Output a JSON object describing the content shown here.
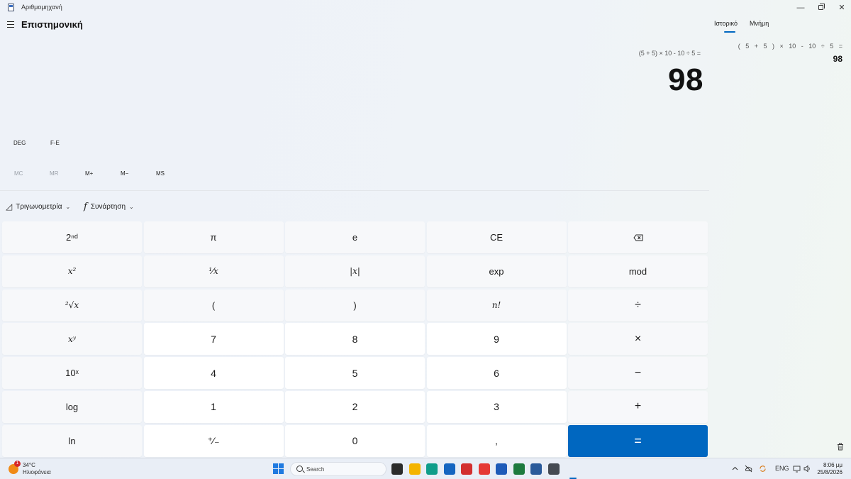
{
  "window": {
    "title": "Αριθμομηχανή",
    "minimize": "—",
    "close": "✕"
  },
  "header": {
    "mode_title": "Επιστημονική"
  },
  "display": {
    "expression": "(5 + 5) × 10 - 10 ÷ 5 =",
    "result": "98"
  },
  "mode_row": {
    "angle_unit": "DEG",
    "notation": "F-E"
  },
  "memory_row": [
    {
      "label": "MC",
      "enabled": false
    },
    {
      "label": "MR",
      "enabled": false
    },
    {
      "label": "M+",
      "enabled": true
    },
    {
      "label": "M−",
      "enabled": true
    },
    {
      "label": "MS",
      "enabled": true
    }
  ],
  "function_dropdowns": {
    "trigonometry": "Τριγωνομετρία",
    "function": "Συνάρτηση",
    "function_glyph": "f",
    "trig_glyph": "◿",
    "chevron": "⌄"
  },
  "keypad": [
    [
      "2ⁿᵈ",
      "π",
      "e",
      "CE",
      "⌫"
    ],
    [
      "x²",
      "¹⁄x",
      "|x|",
      "exp",
      "mod"
    ],
    [
      "²√x",
      "(",
      ")",
      "n!",
      "÷"
    ],
    [
      "xʸ",
      "7",
      "8",
      "9",
      "×"
    ],
    [
      "10ˣ",
      "4",
      "5",
      "6",
      "−"
    ],
    [
      "log",
      "1",
      "2",
      "3",
      "+"
    ],
    [
      "ln",
      "⁺⁄₋",
      "0",
      ",",
      "="
    ]
  ],
  "history_panel": {
    "tabs": [
      {
        "label": "Ιστορικό",
        "active": true
      },
      {
        "label": "Μνήμη",
        "active": false
      }
    ],
    "entries": [
      {
        "expression": "( 5 + 5 ) × 10 - 10 ÷ 5 =",
        "result": "98"
      }
    ]
  },
  "taskbar": {
    "weather": {
      "badge": "1",
      "temp": "34°C",
      "desc": "Ηλιοφάνεια"
    },
    "search_label": "Search",
    "apps": [
      {
        "name": "task-view",
        "color": "#2b2b2b"
      },
      {
        "name": "file-explorer",
        "color": "#f4b400"
      },
      {
        "name": "edge",
        "color": "#0f9d8a"
      },
      {
        "name": "outlook",
        "color": "#1565c0"
      },
      {
        "name": "media",
        "color": "#d32f2f"
      },
      {
        "name": "chrome",
        "color": "#e53935"
      },
      {
        "name": "word",
        "color": "#1e5bb8"
      },
      {
        "name": "excel",
        "color": "#1d7a3e"
      },
      {
        "name": "app-blue",
        "color": "#2a5a9a"
      },
      {
        "name": "calculator",
        "color": "#454a52"
      }
    ],
    "tray": {
      "language": "ENG",
      "time": "8:06 μμ",
      "date": "25/8/2026"
    }
  }
}
